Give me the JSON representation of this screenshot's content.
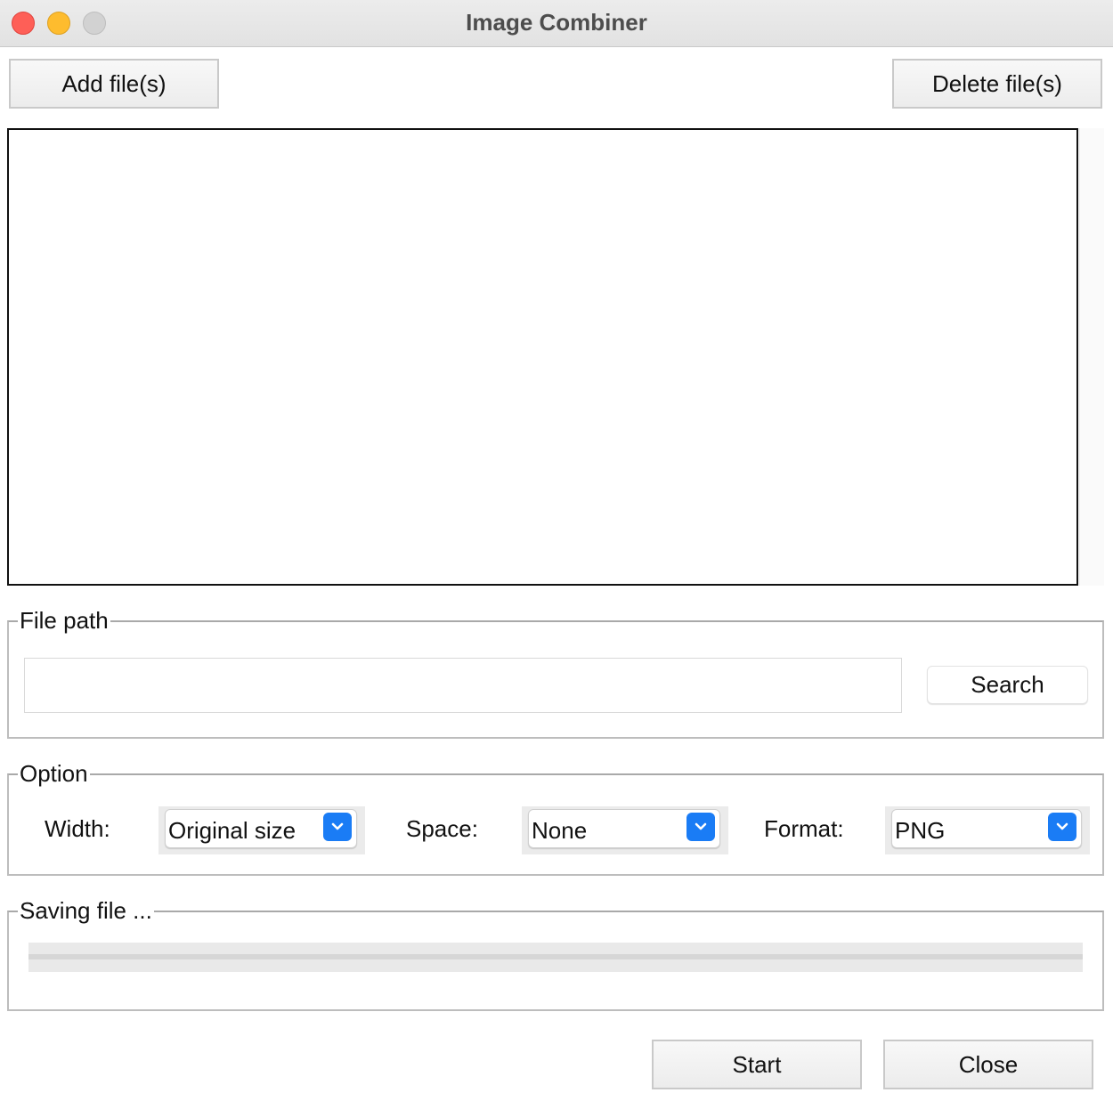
{
  "window": {
    "title": "Image Combiner"
  },
  "toolbar": {
    "add_label": "Add file(s)",
    "delete_label": "Delete file(s)"
  },
  "file_list": {
    "items": []
  },
  "file_path": {
    "group_label": "File path",
    "value": "",
    "placeholder": "",
    "search_label": "Search"
  },
  "options": {
    "group_label": "Option",
    "width_label": "Width:",
    "width_value": "Original size",
    "space_label": "Space:",
    "space_value": "None",
    "format_label": "Format:",
    "format_value": "PNG",
    "accent_color": "#1a7cf5"
  },
  "saving": {
    "group_label": "Saving file ...",
    "progress": 0
  },
  "actions": {
    "start_label": "Start",
    "close_label": "Close"
  }
}
